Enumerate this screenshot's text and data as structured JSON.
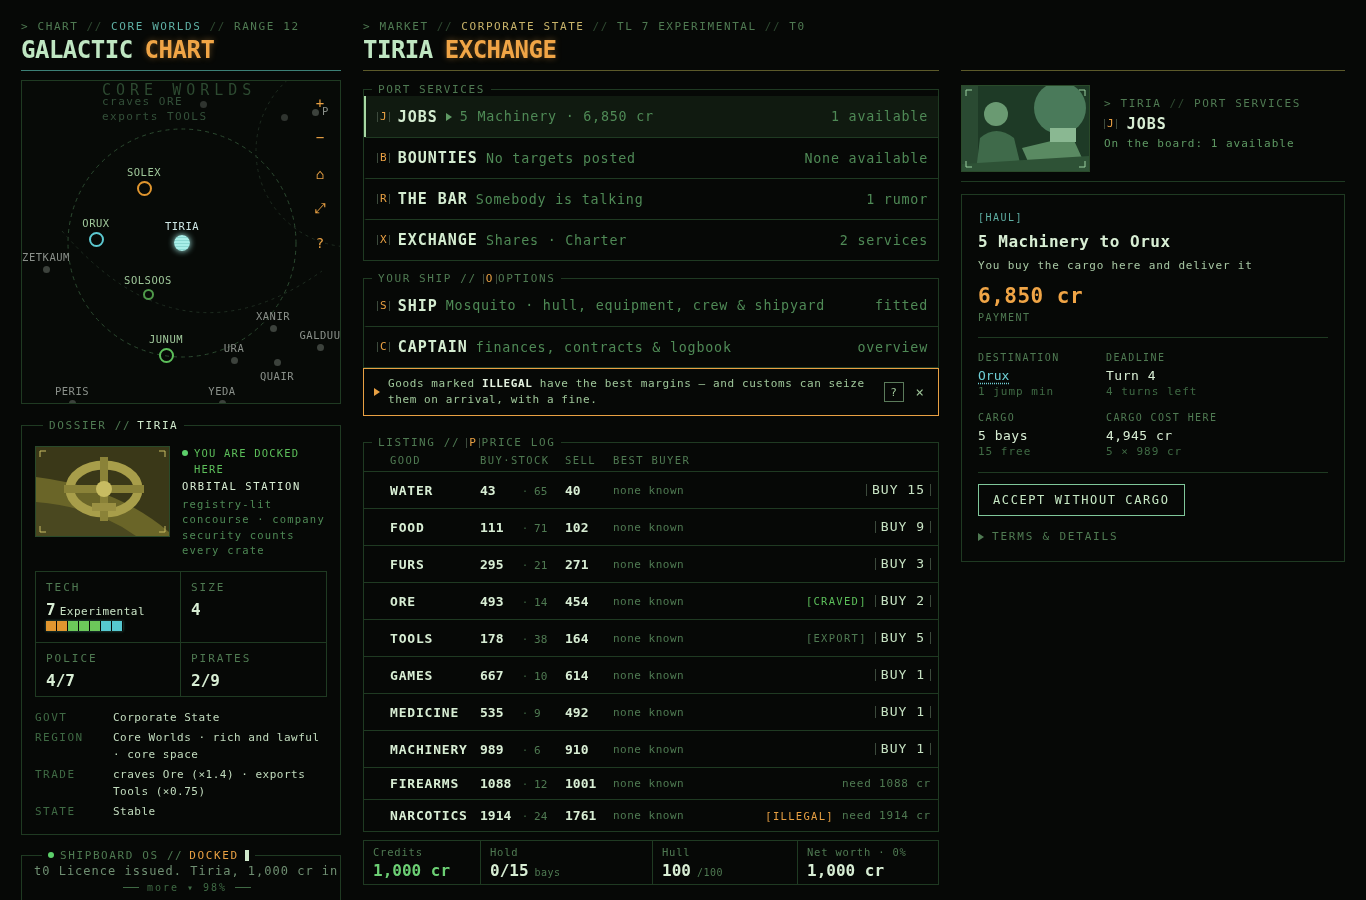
{
  "chart_panel": {
    "crumbs": [
      {
        "text": "> CHART",
        "kind": "dim"
      },
      {
        "text": "//",
        "kind": "sep"
      },
      {
        "text": "CORE WORLDS",
        "kind": "teal"
      },
      {
        "text": "//",
        "kind": "sep"
      },
      {
        "text": "RANGE 12",
        "kind": "dim"
      }
    ],
    "title": {
      "main": "GALACTIC",
      "accent": "CHART"
    },
    "map": {
      "region": "CORE WORLDS",
      "notes": [
        "craves ORE",
        "exports TOOLS"
      ],
      "systems": [
        {
          "name": "SOLEX",
          "kind": "ring",
          "color": "#e0962f"
        },
        {
          "name": "ORUX",
          "kind": "ring",
          "color": "#5cc8d0"
        },
        {
          "name": "TIRIA",
          "kind": "current",
          "color": "#a8eee8"
        },
        {
          "name": "ZETKAUM",
          "kind": "dot",
          "color": "#3c423c"
        },
        {
          "name": "SOLSOOS",
          "kind": "ring",
          "color": "#4f9a4a"
        },
        {
          "name": "XANIR",
          "kind": "dot",
          "color": "#3c423c"
        },
        {
          "name": "GALDUU",
          "kind": "dot",
          "color": "#3c423c"
        },
        {
          "name": "JUNUM",
          "kind": "ring",
          "color": "#5cbf5a"
        },
        {
          "name": "URA",
          "kind": "dot",
          "color": "#3c423c"
        },
        {
          "name": "QUAIR",
          "kind": "dot",
          "color": "#3c423c"
        },
        {
          "name": "PERIS",
          "kind": "dot",
          "color": "#3c423c"
        },
        {
          "name": "YEDA",
          "kind": "dot",
          "color": "#3c423c"
        },
        {
          "name": "P",
          "kind": "dot",
          "color": "#3c423c"
        }
      ],
      "controls": [
        "+",
        "−",
        "⌂",
        "⤢",
        "?"
      ]
    }
  },
  "dossier": {
    "legend": [
      {
        "text": "DOSSIER //",
        "kind": "dim"
      },
      {
        "text": "TIRIA",
        "kind": "bright"
      }
    ],
    "docked": "YOU ARE DOCKED HERE",
    "station": "ORBITAL STATION",
    "description": "registry-lit concourse · company security counts every crate",
    "stats": [
      {
        "label": "TECH",
        "value": "7",
        "note": "Experimental",
        "level": 1
      },
      {
        "label": "SIZE",
        "value": "4"
      },
      {
        "label": "POLICE",
        "value": "4/7"
      },
      {
        "label": "PIRATES",
        "value": "2/9"
      }
    ],
    "facts": [
      {
        "key": "GOVT",
        "value": "Corporate State"
      },
      {
        "key": "REGION",
        "value": "Core Worlds · rich and lawful · core space"
      },
      {
        "key": "TRADE",
        "value": "craves Ore (×1.4) · exports Tools (×0.75)"
      },
      {
        "key": "STATE",
        "value": "Stable"
      }
    ]
  },
  "shipboard": {
    "title": "SHIPBOARD OS //",
    "status": "DOCKED",
    "log": "t0 Licence issued. Tiria, 1,000 cr in",
    "more": "more ▾ 98%"
  },
  "market": {
    "crumbs": [
      {
        "text": "> MARKET",
        "kind": "dim"
      },
      {
        "text": "//",
        "kind": "sep"
      },
      {
        "text": "CORPORATE STATE",
        "kind": "tan"
      },
      {
        "text": "//",
        "kind": "sep"
      },
      {
        "text": "TL 7 EXPERIMENTAL",
        "kind": "dim"
      },
      {
        "text": "//",
        "kind": "sep"
      },
      {
        "text": "T0",
        "kind": "dim"
      }
    ],
    "title": {
      "main": "TIRIA",
      "accent": "EXCHANGE"
    }
  },
  "port_services": {
    "legend": [
      {
        "text": "PORT SERVICES"
      }
    ],
    "items": [
      {
        "key": "J",
        "title": "JOBS",
        "arrow": true,
        "detail": "5 Machinery · 6,850 cr",
        "status": "1 available",
        "selected": true
      },
      {
        "key": "B",
        "title": "BOUNTIES",
        "arrow": false,
        "detail": "No targets posted",
        "status": "None available",
        "selected": false
      },
      {
        "key": "R",
        "title": "THE BAR",
        "arrow": false,
        "detail": "Somebody is talking",
        "status": "1 rumor",
        "selected": false
      },
      {
        "key": "X",
        "title": "EXCHANGE",
        "arrow": false,
        "detail": "Shares · Charter",
        "status": "2 services",
        "selected": false
      }
    ]
  },
  "your_ship": {
    "legend": [
      {
        "text": "YOUR SHIP //"
      },
      {
        "key": "O",
        "text": "OPTIONS"
      }
    ],
    "items": [
      {
        "key": "S",
        "title": "SHIP",
        "arrow": false,
        "detail": "Mosquito · hull, equipment, crew & shipyard",
        "status": "fitted",
        "selected": false
      },
      {
        "key": "C",
        "title": "CAPTAIN",
        "arrow": false,
        "detail": "finances, contracts & logbook",
        "status": "overview",
        "selected": false
      }
    ]
  },
  "alert": {
    "text": "Goods marked **ILLEGAL** have the best margins — and customs can seize them on arrival, with a fine.",
    "help": "?",
    "close": "×"
  },
  "listing": {
    "legend": [
      {
        "text": "LISTING //"
      },
      {
        "key": "P",
        "text": "PRICE LOG"
      }
    ],
    "columns": [
      "GOOD",
      "BUY·STOCK",
      "SELL",
      "BEST BUYER"
    ],
    "rows": [
      {
        "good": "WATER",
        "buy": "43",
        "stock": "65",
        "dot": "·",
        "sell": "40",
        "best_buyer": "none known",
        "action": {
          "kind": "buy",
          "text": "BUY 15"
        }
      },
      {
        "good": "FOOD",
        "buy": "111",
        "stock": "71",
        "dot": "·",
        "sell": "102",
        "best_buyer": "none known",
        "action": {
          "kind": "buy",
          "text": "BUY 9"
        }
      },
      {
        "good": "FURS",
        "buy": "295",
        "stock": "21",
        "dot": "·",
        "sell": "271",
        "best_buyer": "none known",
        "action": {
          "kind": "buy",
          "text": "BUY 3"
        }
      },
      {
        "good": "ORE",
        "buy": "493",
        "stock": "14",
        "dot": "·",
        "sell": "454",
        "best_buyer": "none known",
        "tag": {
          "kind": "craved",
          "text": "[CRAVED]"
        },
        "action": {
          "kind": "buy",
          "text": "BUY 2"
        }
      },
      {
        "good": "TOOLS",
        "buy": "178",
        "stock": "38",
        "dot": "·",
        "sell": "164",
        "best_buyer": "none known",
        "tag": {
          "kind": "export",
          "text": "[EXPORT]"
        },
        "action": {
          "kind": "buy",
          "text": "BUY 5"
        }
      },
      {
        "good": "GAMES",
        "buy": "667",
        "stock": "10",
        "dot": "·",
        "sell": "614",
        "best_buyer": "none known",
        "action": {
          "kind": "buy",
          "text": "BUY 1"
        }
      },
      {
        "good": "MEDICINE",
        "buy": "535",
        "stock": "9",
        "dot": "·",
        "sell": "492",
        "best_buyer": "none known",
        "action": {
          "kind": "buy",
          "text": "BUY 1"
        }
      },
      {
        "good": "MACHINERY",
        "buy": "989",
        "stock": "6",
        "dot": "·",
        "sell": "910",
        "best_buyer": "none known",
        "action": {
          "kind": "buy",
          "text": "BUY 1"
        }
      },
      {
        "good": "FIREARMS",
        "buy": "1088",
        "stock": "12",
        "dot": "·",
        "sell": "1001",
        "best_buyer": "none known",
        "action": {
          "kind": "need",
          "text": "need 1088 cr"
        }
      },
      {
        "good": "NARCOTICS",
        "buy": "1914",
        "stock": "24",
        "dot": "·",
        "sell": "1761",
        "best_buyer": "none known",
        "tag": {
          "kind": "illegal",
          "text": "[ILLEGAL]"
        },
        "action": {
          "kind": "need",
          "text": "need 1914 cr"
        }
      }
    ]
  },
  "status_bar": [
    {
      "label": "Credits",
      "value": "1,000 cr",
      "kind": "credits"
    },
    {
      "label": "Hold",
      "value": "0/15",
      "unit": "bays",
      "kind": "plain"
    },
    {
      "label": "Hull",
      "value": "100",
      "unit": "/100",
      "kind": "plain"
    },
    {
      "label": "Net worth · 0%",
      "value": "1,000 cr",
      "kind": "plain"
    }
  ],
  "detail": {
    "crumbs": [
      {
        "text": "> TIRIA",
        "kind": "dim"
      },
      {
        "text": "//",
        "kind": "sep"
      },
      {
        "text": "PORT SERVICES",
        "kind": "dim"
      }
    ],
    "key": "J",
    "title": "JOBS",
    "subtitle": "On the board: 1 available",
    "job": {
      "tag": "[HAUL]",
      "title": "5 Machinery to Orux",
      "description": "You buy the cargo here and deliver it",
      "payment": "6,850 cr",
      "payment_label": "PAYMENT",
      "fields": [
        {
          "label": "DESTINATION",
          "value": "Orux",
          "sub": "1 jump min",
          "kind": "link"
        },
        {
          "label": "DEADLINE",
          "value": "Turn 4",
          "sub": "4 turns left",
          "kind": "text"
        },
        {
          "label": "CARGO",
          "value": "5 bays",
          "sub": "15 free",
          "kind": "text"
        },
        {
          "label": "CARGO COST HERE",
          "value": "4,945 cr",
          "sub": "5 × 989 cr",
          "kind": "text"
        }
      ],
      "button": "ACCEPT WITHOUT CARGO",
      "terms": "TERMS & DETAILS"
    }
  }
}
